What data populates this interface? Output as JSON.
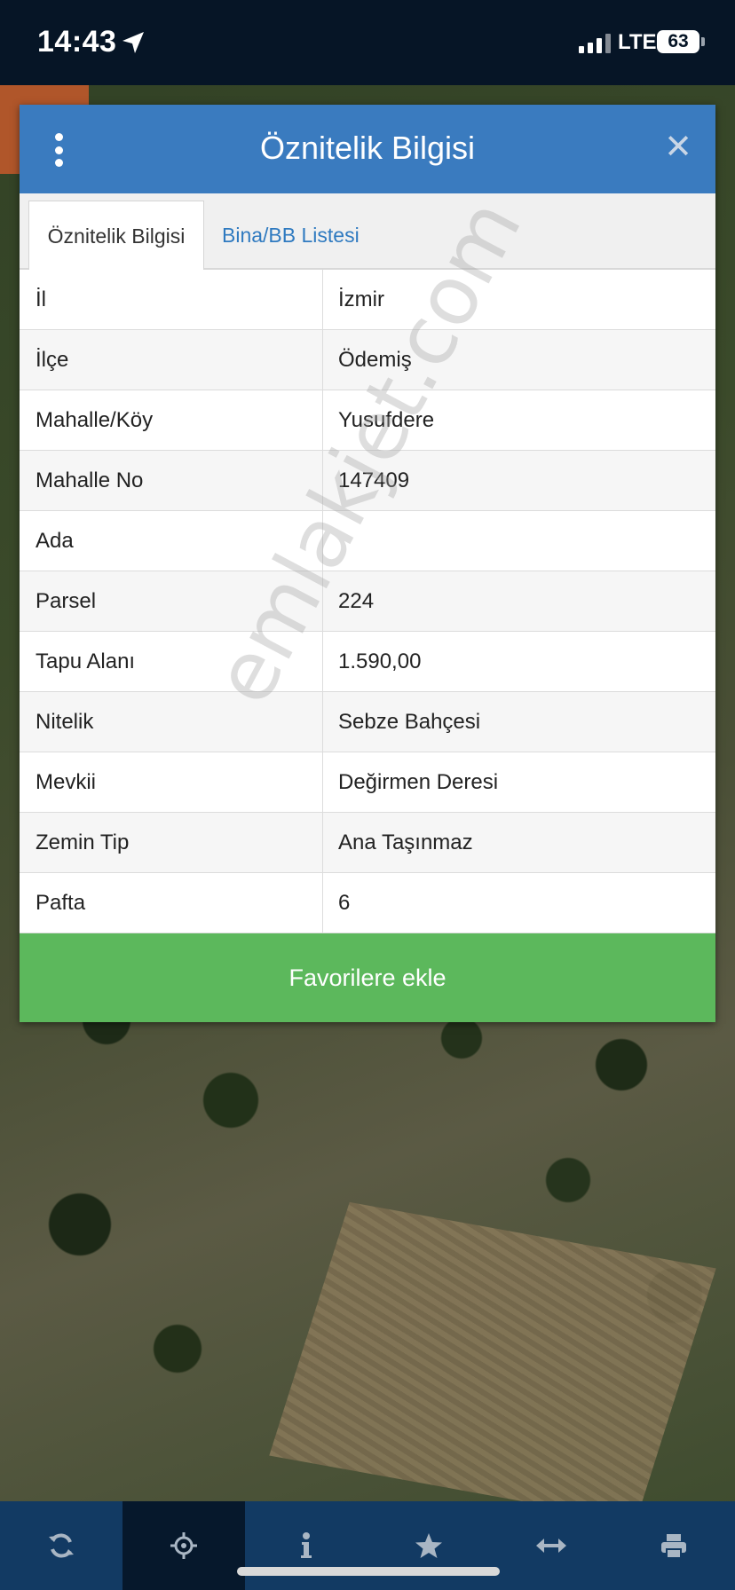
{
  "status_bar": {
    "time": "14:43",
    "network": "LTE",
    "battery": "63"
  },
  "dialog": {
    "title": "Öznitelik Bilgisi",
    "menu_icon": "kebab-menu-icon",
    "close_icon": "close-icon",
    "tabs": [
      {
        "label": "Öznitelik Bilgisi",
        "active": true
      },
      {
        "label": "Bina/BB Listesi",
        "active": false
      }
    ],
    "rows": [
      {
        "key": "İl",
        "value": "İzmir"
      },
      {
        "key": "İlçe",
        "value": "Ödemiş"
      },
      {
        "key": "Mahalle/Köy",
        "value": "Yusufdere"
      },
      {
        "key": "Mahalle No",
        "value": "147409"
      },
      {
        "key": "Ada",
        "value": ""
      },
      {
        "key": "Parsel",
        "value": "224"
      },
      {
        "key": "Tapu Alanı",
        "value": "1.590,00"
      },
      {
        "key": "Nitelik",
        "value": "Sebze Bahçesi"
      },
      {
        "key": "Mevkii",
        "value": "Değirmen Deresi"
      },
      {
        "key": "Zemin Tip",
        "value": "Ana Taşınmaz"
      },
      {
        "key": "Pafta",
        "value": "6"
      }
    ],
    "favorite_button": "Favorilere ekle"
  },
  "watermark": "emlakjet.com",
  "toolbar": {
    "items": [
      {
        "icon": "refresh-icon",
        "active": false
      },
      {
        "icon": "crosshair-icon",
        "active": true
      },
      {
        "icon": "info-icon",
        "active": false
      },
      {
        "icon": "star-icon",
        "active": false
      },
      {
        "icon": "measure-icon",
        "active": false
      },
      {
        "icon": "print-icon",
        "active": false
      }
    ]
  },
  "colors": {
    "header": "#3a7bbf",
    "button": "#5cb85c",
    "toolbar": "#123a63",
    "statusbar": "#061526"
  }
}
